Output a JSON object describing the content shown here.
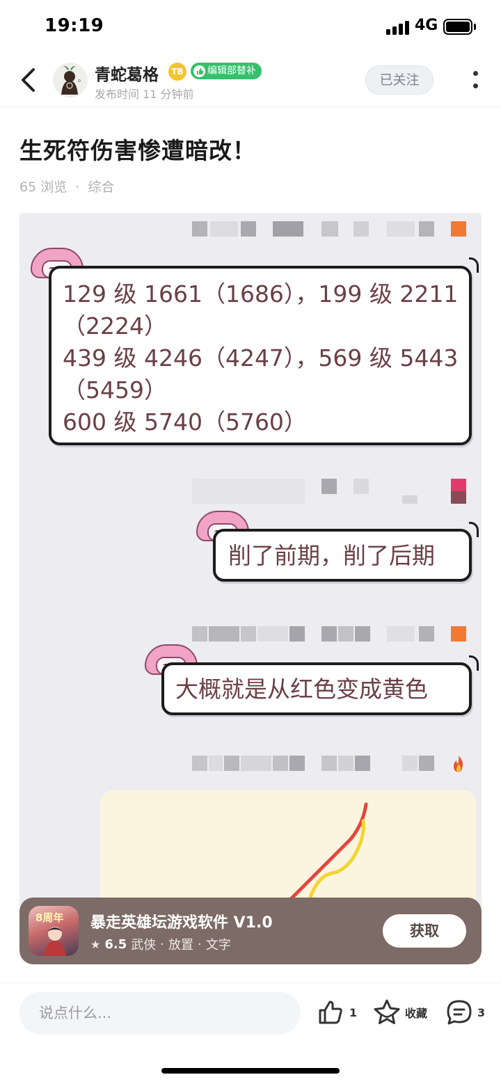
{
  "status_bar": {
    "time": "19:19",
    "network": "4G"
  },
  "header": {
    "author_name": "青蛇葛格",
    "level_badge": "TB",
    "role_badge": "编辑部替补",
    "publish_time": "发布时间 11 分钟前",
    "follow_label": "已关注"
  },
  "post": {
    "title": "生死符伤害惨遭暗改！",
    "views": "65 浏览",
    "separator": "·",
    "category": "综合"
  },
  "image": {
    "messages": [
      {
        "text": "129 级 1661（1686），199 级 2211\n（2224）\n439 级 4246（4247），569 级 5443\n（5459）\n600 级 5740（5760）"
      },
      {
        "text": "削了前期，削了后期"
      },
      {
        "text": "大概就是从红色变成黄色"
      }
    ],
    "sketch_colors": {
      "red": "#e0483e",
      "yellow": "#f2d531"
    }
  },
  "app_card": {
    "name": "暴走英雄坛游戏软件 V1.0",
    "rating": "6.5",
    "tags": [
      "武侠",
      "放置",
      "文字"
    ],
    "tag_separator": "·",
    "anniversary": "8周年",
    "get_label": "获取"
  },
  "bottom_bar": {
    "comment_placeholder": "说点什么...",
    "like_count": "1",
    "favorite_label": "收藏",
    "comment_count": "3"
  },
  "colors": {
    "accent_green": "#35c06b",
    "app_card_bg": "#7c6b66",
    "bubble_text": "#6a3f45"
  }
}
